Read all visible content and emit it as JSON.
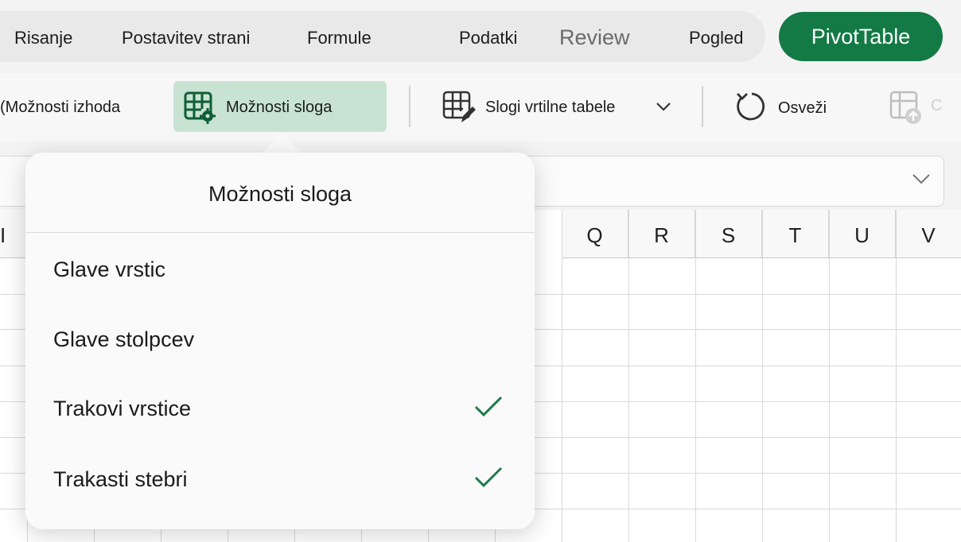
{
  "tabs": {
    "risanje": "Risanje",
    "postavitev": "Postavitev strani",
    "formule": "Formule",
    "podatki": "Podatki",
    "review": "Review",
    "pogled": "Pogled",
    "pivot": "PivotTable"
  },
  "ribbon": {
    "izhod": "(Možnosti izhoda",
    "style_options": "Možnosti sloga",
    "styles": "Slogi vrtilne tabele",
    "refresh": "Osveži",
    "cut_off": "C"
  },
  "columns": [
    "Q",
    "R",
    "S",
    "T",
    "U",
    "V"
  ],
  "partial_col": "I",
  "popover": {
    "title": "Možnosti sloga",
    "options": [
      {
        "label": "Glave vrstic",
        "checked": false
      },
      {
        "label": "Glave stolpcev",
        "checked": false
      },
      {
        "label": "Trakovi vrstice",
        "checked": true
      },
      {
        "label": "Trakasti stebri",
        "checked": true
      }
    ]
  },
  "colors": {
    "accent": "#137a45",
    "selected_button": "#c9e3d3",
    "check": "#1e7a4a"
  },
  "icons": [
    "table-gear-icon",
    "table-pencil-icon",
    "chevron-down-icon",
    "refresh-icon",
    "table-upload-icon",
    "checkmark-icon"
  ]
}
